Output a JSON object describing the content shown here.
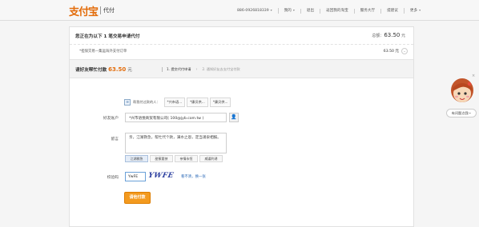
{
  "header": {
    "logo_main": "支付宝",
    "logo_sub": "代付",
    "nav": [
      {
        "label": "886-0926818339",
        "has_caret": true
      },
      {
        "label": "我的",
        "has_caret": true
      },
      {
        "label": "退出",
        "has_caret": false
      },
      {
        "label": "返回我的淘宝",
        "has_caret": false
      },
      {
        "label": "服务大厅",
        "has_caret": false
      },
      {
        "label": "提建议",
        "has_caret": false
      },
      {
        "label": "更多",
        "has_caret": true
      }
    ]
  },
  "payment": {
    "heading": "您正在为以下 1 笔交易申请代付",
    "total_label": "总额：",
    "total_amount": "63.50",
    "currency": "元",
    "order_name": "*担保交易—集运海外支付订单",
    "order_amount": "63.50 元"
  },
  "section": {
    "title_prefix": "请好友帮忙付款",
    "amount": "63.50",
    "unit": "元",
    "steps": [
      {
        "label": "1. 提交代付申请",
        "active": true
      },
      {
        "label": "2. 通知好友去支付宝付款",
        "active": false
      }
    ]
  },
  "form": {
    "recent_friends_label": "帮我付过款的人：",
    "recent_friends": [
      "*兴市语...",
      "*康贝供...",
      "*康贝供..."
    ],
    "friend_account_label": "好友账户",
    "friend_account_value": "*兴市语悦商贸有限公司( 100@jyb.com.tw )",
    "message_label": "留言",
    "message_value": "亲，江湖救急，帮忙代个款，满水之恩，定当涌泉相报。",
    "quick_messages": [
      "江湖救急",
      "甜蜜要挟",
      "亲情永恒",
      "威逼利诱"
    ],
    "quick_active_index": 0,
    "captcha_label": "校验码",
    "captcha_value": "YwFE",
    "captcha_image_text": "YWFE",
    "captcha_refresh": "看不清，换一张",
    "submit_label": "请他付款"
  },
  "side_widget": {
    "help_label": "有问题点我~",
    "close_icon": "×"
  },
  "colors": {
    "accent": "#e36c0a",
    "button": "#f39a1f",
    "link": "#2d6bb8"
  }
}
